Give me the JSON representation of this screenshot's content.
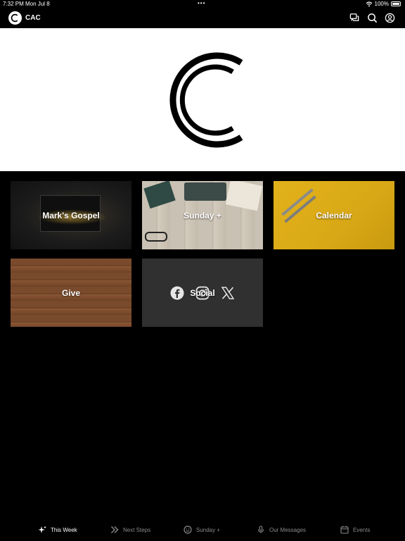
{
  "status_bar": {
    "time": "7:32 PM",
    "date": "Mon Jul 8",
    "dots": "•••",
    "battery": "100%"
  },
  "header": {
    "title": "CAC",
    "icons": [
      "chat-icon",
      "search-icon",
      "account-icon"
    ]
  },
  "tiles": [
    {
      "label": "Mark's Gospel"
    },
    {
      "label": "Sunday +"
    },
    {
      "label": "Calendar"
    },
    {
      "label": "Give"
    },
    {
      "label": "Social",
      "icons": [
        "facebook-icon",
        "instagram-icon",
        "x-icon"
      ]
    }
  ],
  "tabs": [
    {
      "label": "This Week",
      "icon": "sparkle-icon",
      "active": true
    },
    {
      "label": "Next Steps",
      "icon": "chevrons-right-icon",
      "active": false
    },
    {
      "label": "Sunday +",
      "icon": "smile-icon",
      "active": false
    },
    {
      "label": "Our Messages",
      "icon": "microphone-icon",
      "active": false
    },
    {
      "label": "Events",
      "icon": "calendar-icon",
      "active": false
    }
  ],
  "colors": {
    "background": "#000000",
    "hero": "#ffffff",
    "calendar_tile": "#e0b01a",
    "social_tile": "#303030",
    "inactive_tab": "#8a8a8a"
  }
}
